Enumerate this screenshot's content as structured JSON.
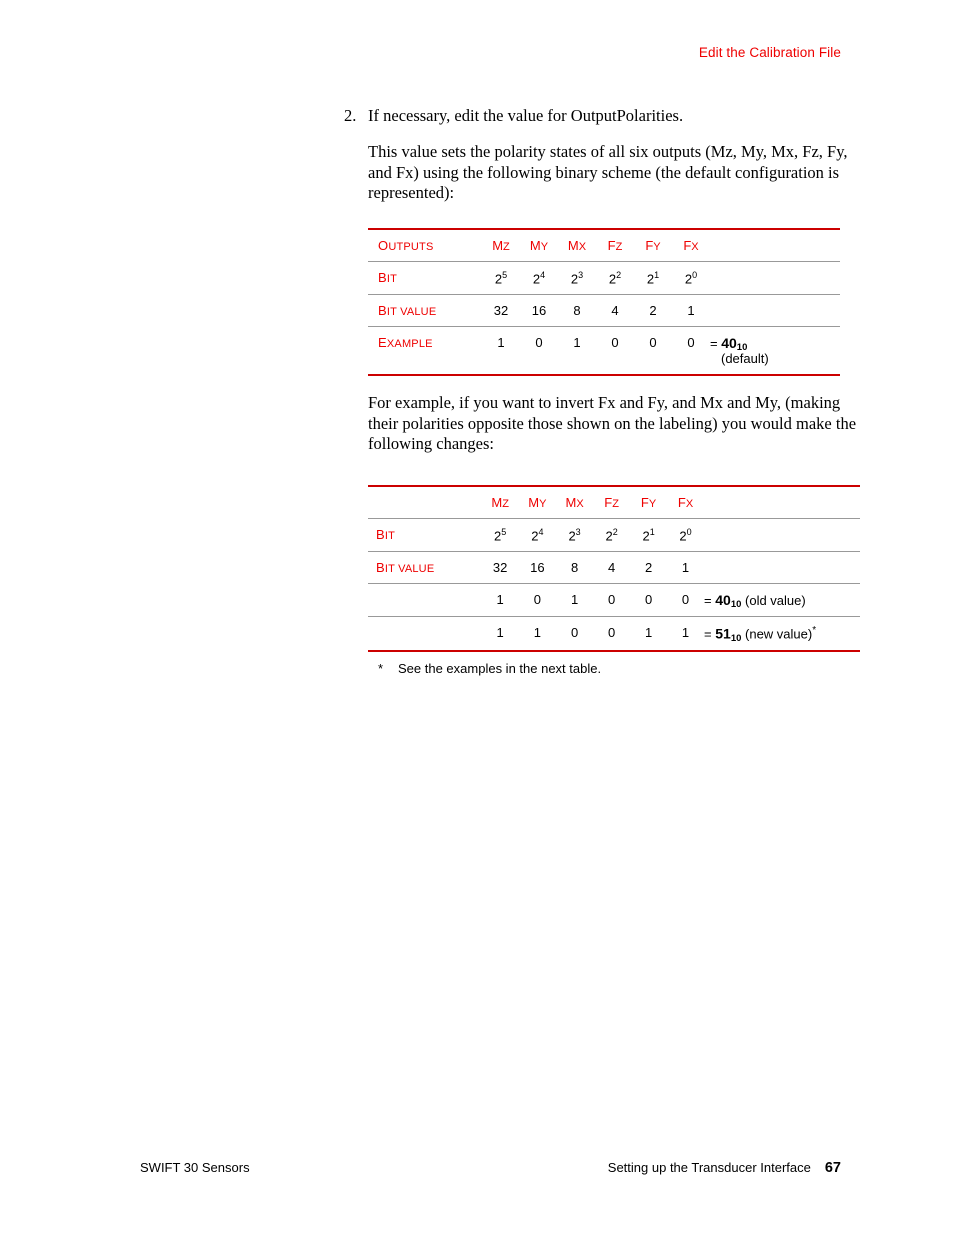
{
  "header": {
    "running_head": "Edit the Calibration File",
    "color": "#ee0000"
  },
  "content": {
    "step": {
      "number": "2.",
      "text": "If necessary, edit the value for OutputPolarities."
    },
    "paragraph_1": "This value sets the polarity states of all six outputs (Mz, My, Mx, Fz, Fy, and Fx) using the following binary scheme (the default configuration is represented):",
    "paragraph_2": "For example, if you want to invert Fx and Fy, and Mx and My, (making their polarities opposite those shown on the labeling) you would make the following changes:",
    "footnote": {
      "marker": "*",
      "text": "See the examples in the next table."
    }
  },
  "table1": {
    "header_label": "Outputs",
    "header_label_cap": "O",
    "header_label_rest": "UTPUTS",
    "columns": [
      {
        "cap": "M",
        "sub": "Z",
        "full": "Mz"
      },
      {
        "cap": "M",
        "sub": "Y",
        "full": "My"
      },
      {
        "cap": "M",
        "sub": "X",
        "full": "Mx"
      },
      {
        "cap": "F",
        "sub": "Z",
        "full": "Fz"
      },
      {
        "cap": "F",
        "sub": "Y",
        "full": "Fy"
      },
      {
        "cap": "F",
        "sub": "X",
        "full": "Fx"
      }
    ],
    "rows": [
      {
        "label_cap": "B",
        "label_rest": "IT",
        "label_full": "Bit",
        "values": [
          "2",
          "2",
          "2",
          "2",
          "2",
          "2"
        ],
        "exponents": [
          "5",
          "4",
          "3",
          "2",
          "1",
          "0"
        ],
        "result": "",
        "result_note": ""
      },
      {
        "label_cap": "B",
        "label_rest": "IT VALUE",
        "label_full": "Bit Value",
        "values": [
          "32",
          "16",
          "8",
          "4",
          "2",
          "1"
        ],
        "exponents": [
          "",
          "",
          "",
          "",
          "",
          ""
        ],
        "result": "",
        "result_note": ""
      },
      {
        "label_cap": "E",
        "label_rest": "XAMPLE",
        "label_full": "Example",
        "values": [
          "1",
          "0",
          "1",
          "0",
          "0",
          "0"
        ],
        "exponents": [
          "",
          "",
          "",
          "",
          "",
          ""
        ],
        "result_prefix": "= ",
        "result_value": "40",
        "result_base": "10",
        "result_note": "(default)"
      }
    ]
  },
  "table2": {
    "header_label": "",
    "columns": [
      {
        "cap": "M",
        "sub": "Z",
        "full": "Mz"
      },
      {
        "cap": "M",
        "sub": "Y",
        "full": "My"
      },
      {
        "cap": "M",
        "sub": "X",
        "full": "Mx"
      },
      {
        "cap": "F",
        "sub": "Z",
        "full": "Fz"
      },
      {
        "cap": "F",
        "sub": "Y",
        "full": "Fy"
      },
      {
        "cap": "F",
        "sub": "X",
        "full": "Fx"
      }
    ],
    "rows": [
      {
        "label_cap": "B",
        "label_rest": "IT",
        "label_full": "Bit",
        "values": [
          "2",
          "2",
          "2",
          "2",
          "2",
          "2"
        ],
        "exponents": [
          "5",
          "4",
          "3",
          "2",
          "1",
          "0"
        ]
      },
      {
        "label_cap": "B",
        "label_rest": "IT VALUE",
        "label_full": "Bit Value",
        "values": [
          "32",
          "16",
          "8",
          "4",
          "2",
          "1"
        ],
        "exponents": [
          "",
          "",
          "",
          "",
          "",
          ""
        ]
      },
      {
        "label_cap": "",
        "label_rest": "",
        "label_full": "",
        "values": [
          "1",
          "0",
          "1",
          "0",
          "0",
          "0"
        ],
        "exponents": [
          "",
          "",
          "",
          "",
          "",
          ""
        ],
        "result_prefix": "= ",
        "result_value": "40",
        "result_base": "10",
        "result_note": " (old value)",
        "result_star": ""
      },
      {
        "label_cap": "",
        "label_rest": "",
        "label_full": "",
        "values": [
          "1",
          "1",
          "0",
          "0",
          "1",
          "1"
        ],
        "exponents": [
          "",
          "",
          "",
          "",
          "",
          ""
        ],
        "result_prefix": "= ",
        "result_value": "51",
        "result_base": "10",
        "result_note": " (new value)",
        "result_star": "*"
      }
    ]
  },
  "footer": {
    "left": "SWIFT 30 Sensors",
    "chapter": "Setting up the Transducer Interface",
    "page_number": "67"
  }
}
